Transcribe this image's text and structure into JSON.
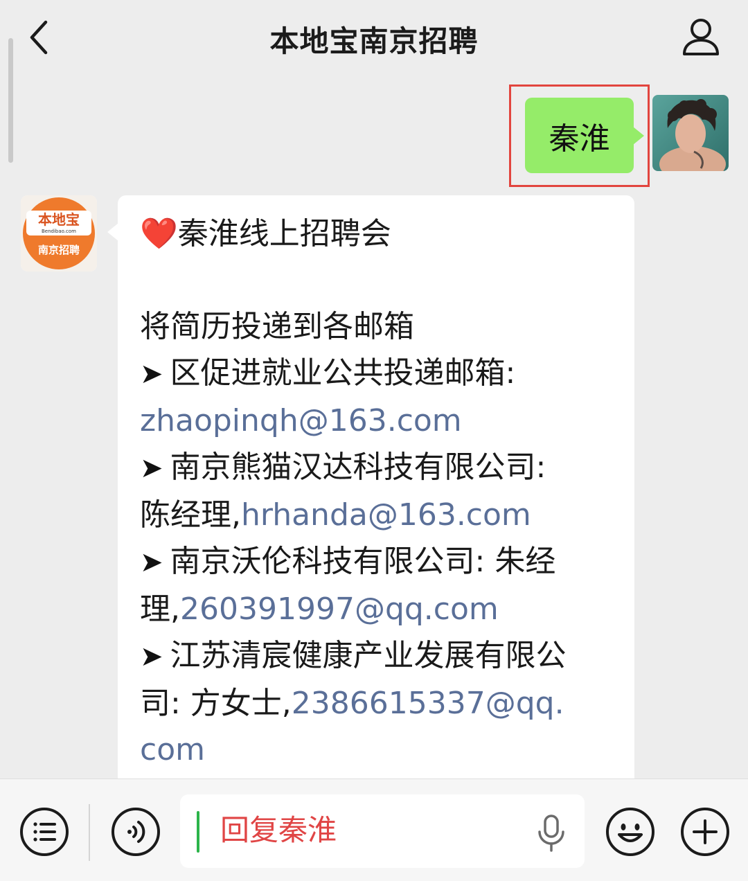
{
  "header": {
    "title": "本地宝南京招聘"
  },
  "outgoing_message": {
    "text": "秦淮"
  },
  "incoming_message": {
    "title": "秦淮线上招聘会",
    "intro": "将简历投递到各邮箱",
    "line1_text": "区促进就业公共投递邮箱:",
    "line1_email": "zhaopinqh@163.com",
    "line2_text": "南京熊猫汉达科技有限公司:",
    "line2_contact": "陈经理,",
    "line2_email": "hrhanda@163.com",
    "line3_text": "南京沃伦科技有限公司: 朱经",
    "line3_contact": "理,",
    "line3_email": "260391997@qq.com",
    "line4_text": "江苏清宸健康产业发展有限公",
    "line4_contact": "司: 方女士,",
    "line4_email_a": "2386615337@qq.",
    "line4_email_b": "com",
    "arrow": "➤",
    "heart": "❤️"
  },
  "bot_avatar": {
    "brand": "本地宝",
    "site": "Bendibao.com",
    "sub": "南京招聘"
  },
  "input_bar": {
    "placeholder": "回复秦淮"
  },
  "icons": {
    "back": "chevron-left-icon",
    "profile": "person-icon",
    "menu": "list-icon",
    "voice": "voice-icon",
    "mic": "microphone-icon",
    "emoji": "smiley-icon",
    "plus": "plus-icon"
  },
  "colors": {
    "outgoing_bubble": "#95ec69",
    "link": "#5a6f98",
    "highlight_box": "#e2453e",
    "placeholder": "#e04545",
    "caret": "#2cb44a",
    "brand_orange": "#ef7a2c"
  }
}
